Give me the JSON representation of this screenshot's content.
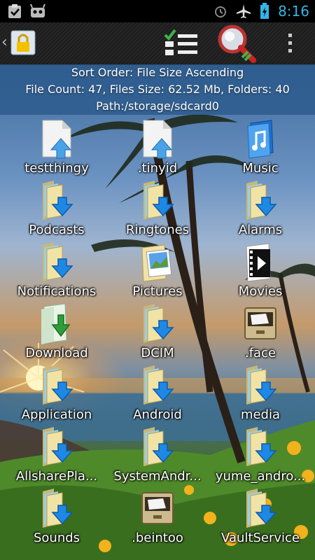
{
  "status_bar": {
    "time": "8:16"
  },
  "info_panel": {
    "sort_order": "Sort Order: File Size Ascending",
    "counts": "File Count: 47, Files Size: 62.52 Mb, Folders: 40",
    "path": "Path:/storage/sdcard0"
  },
  "grid": {
    "items": [
      {
        "label": "testthingy",
        "icon": "file-upload-icon"
      },
      {
        "label": ".tinyid",
        "icon": "file-upload-icon"
      },
      {
        "label": "Music",
        "icon": "music-folder-icon"
      },
      {
        "label": "Podcasts",
        "icon": "folder-download-icon"
      },
      {
        "label": "Ringtones",
        "icon": "folder-download-icon"
      },
      {
        "label": "Alarms",
        "icon": "folder-download-icon"
      },
      {
        "label": "Notifications",
        "icon": "folder-download-icon"
      },
      {
        "label": "Pictures",
        "icon": "pictures-folder-icon"
      },
      {
        "label": "Movies",
        "icon": "movies-folder-icon"
      },
      {
        "label": "Download",
        "icon": "download-folder-icon"
      },
      {
        "label": "DCIM",
        "icon": "folder-download-icon"
      },
      {
        "label": ".face",
        "icon": "archive-drawer-icon"
      },
      {
        "label": "Application",
        "icon": "folder-download-icon"
      },
      {
        "label": "Android",
        "icon": "folder-download-icon"
      },
      {
        "label": "media",
        "icon": "folder-download-icon"
      },
      {
        "label": "AllsharePla...",
        "icon": "folder-download-icon"
      },
      {
        "label": "SystemAndr...",
        "icon": "folder-download-icon"
      },
      {
        "label": "yume_andro...",
        "icon": "folder-download-icon"
      },
      {
        "label": "Sounds",
        "icon": "folder-download-icon"
      },
      {
        "label": ".beintoo",
        "icon": "archive-drawer-icon"
      },
      {
        "label": "VaultService",
        "icon": "folder-download-icon"
      }
    ]
  },
  "colors": {
    "clock": "#33b5e5",
    "info_panel_bg": "#2c5a8c",
    "action_bar_bg": "#1d1d1d"
  }
}
